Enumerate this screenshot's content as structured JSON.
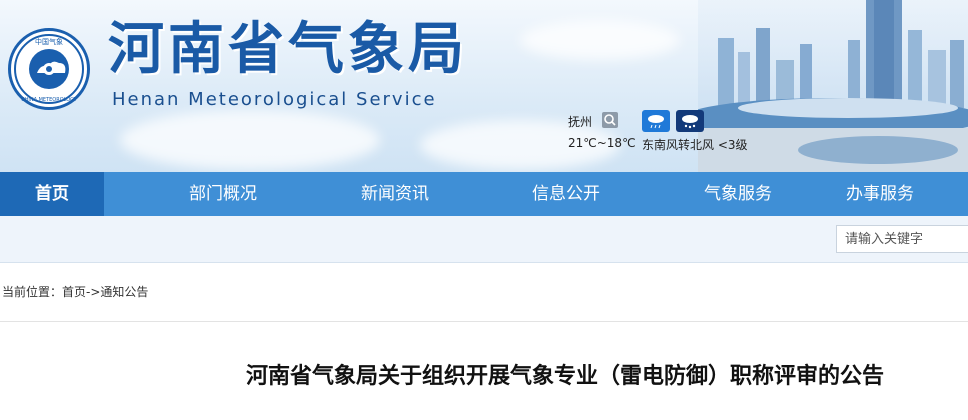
{
  "header": {
    "title_cn": "河南省气象局",
    "title_en": "Henan  Meteorological  Service",
    "logo": {
      "top_text": "中国气象",
      "ring_text": "CHINA METEOROLOGY"
    }
  },
  "weather": {
    "city": "抚州",
    "temperature": "21℃~18℃",
    "wind": "东南风转北风 <3级",
    "icons": [
      "light-rain-icon",
      "snow-rain-icon"
    ]
  },
  "nav": {
    "items": [
      {
        "label": "首页",
        "active": true
      },
      {
        "label": "部门概况",
        "active": false
      },
      {
        "label": "新闻资讯",
        "active": false
      },
      {
        "label": "信息公开",
        "active": false
      },
      {
        "label": "气象服务",
        "active": false
      },
      {
        "label": "办事服务",
        "active": false
      }
    ]
  },
  "search": {
    "placeholder": "请输入关键字"
  },
  "breadcrumb": {
    "prefix": "当前位置：",
    "home": "首页",
    "separator": "->",
    "current": "通知公告"
  },
  "article": {
    "title": "河南省气象局关于组织开展气象专业（雷电防御）职称评审的公告"
  },
  "colors": {
    "nav_bg": "#3f8fd6",
    "nav_active": "#1e69b6",
    "title_blue": "#1a5aa6",
    "search_strip": "#eef4fb"
  }
}
